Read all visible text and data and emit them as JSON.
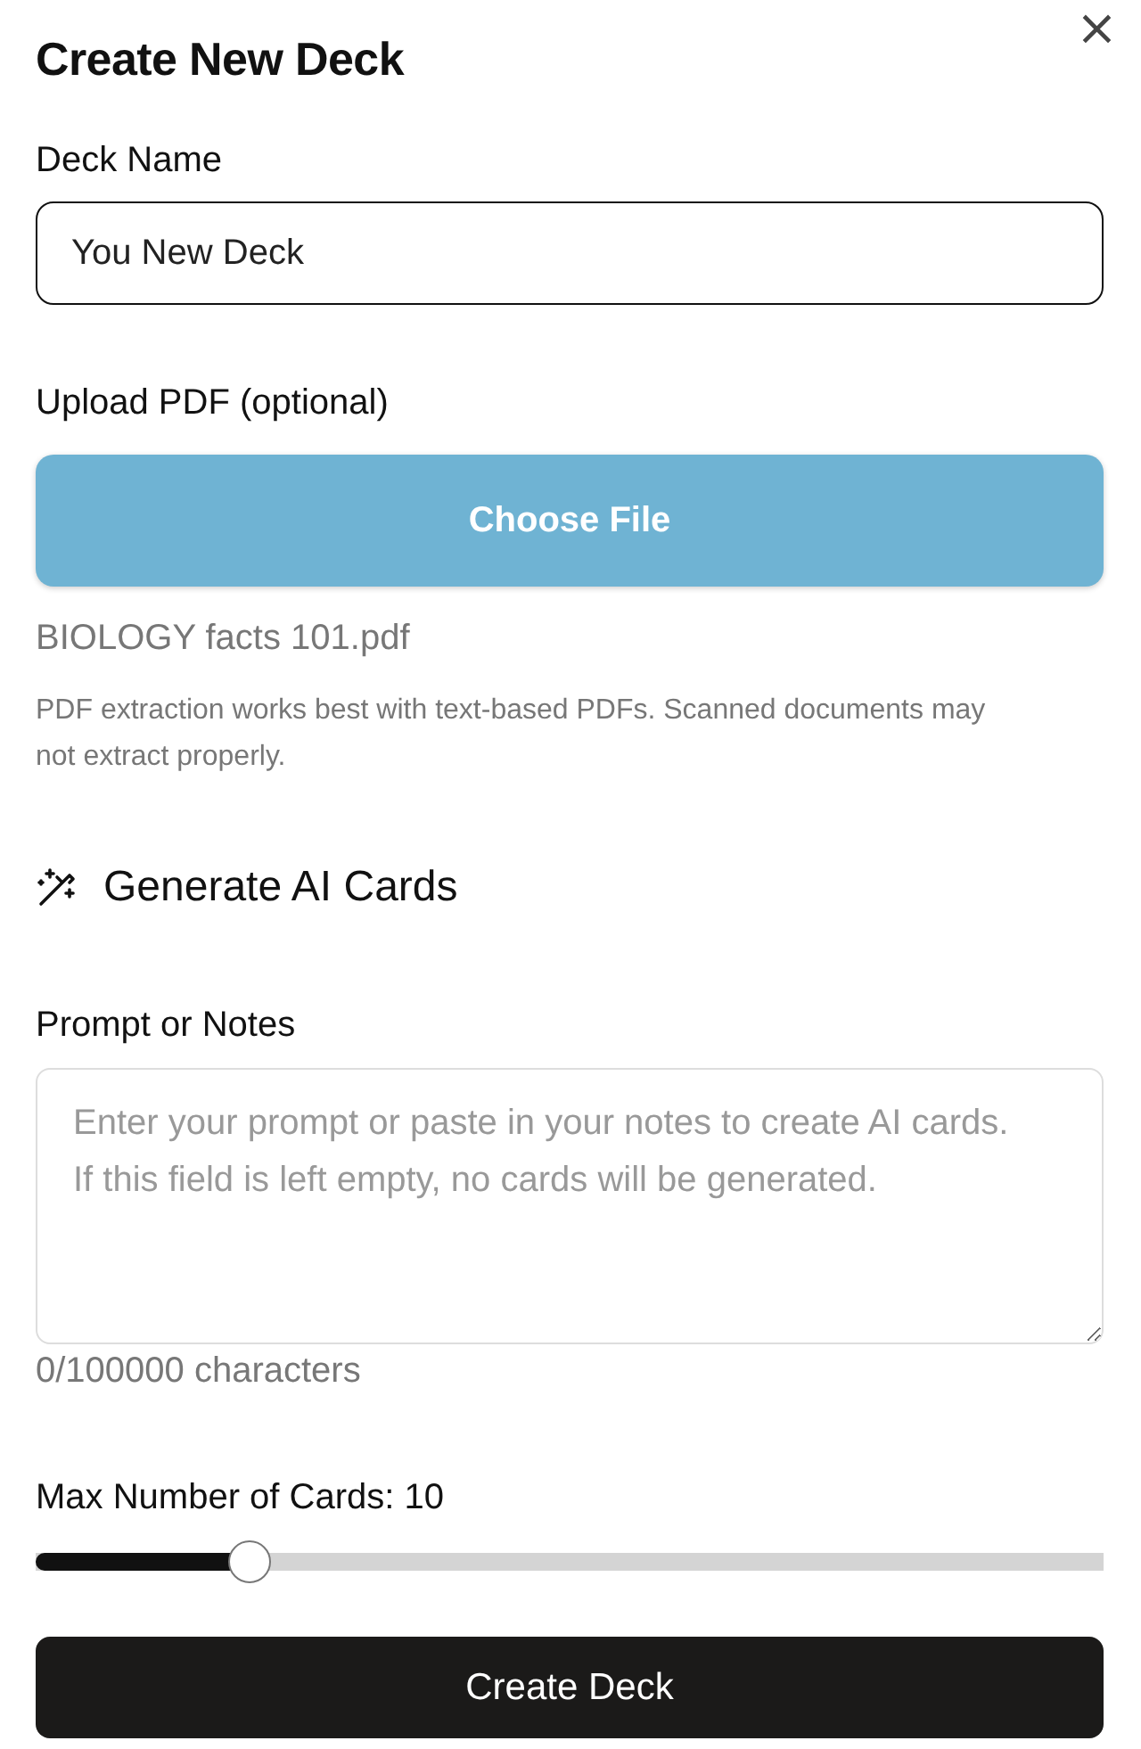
{
  "dialog": {
    "title": "Create New Deck",
    "close": "×"
  },
  "deck_name": {
    "label": "Deck Name",
    "value": "You New Deck",
    "focused": true
  },
  "upload": {
    "label": "Upload PDF (optional)",
    "button": "Choose File",
    "file_name": "BIOLOGY facts 101.pdf",
    "hint": "PDF extraction works best with text-based PDFs. Scanned documents may not extract properly."
  },
  "ai_section": {
    "title": "Generate AI Cards"
  },
  "prompt": {
    "label": "Prompt or Notes",
    "placeholder": "Enter your prompt or paste in your notes to create AI cards. If this field is left empty, no cards will be generated.",
    "counter": "0/100000 characters"
  },
  "max_cards": {
    "label": "Max Number of Cards: 10",
    "level": 0.2
  },
  "submit": "Create Deck"
}
